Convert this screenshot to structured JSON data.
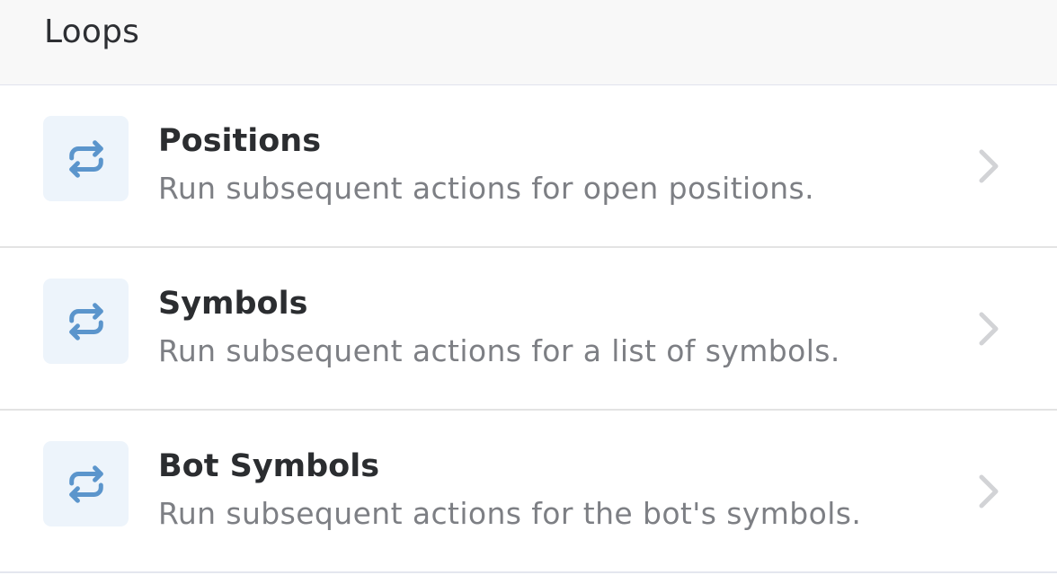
{
  "section": {
    "title": "Loops"
  },
  "accent_color": "#5b95cc",
  "items": [
    {
      "icon": "repeat-icon",
      "title": "Positions",
      "description": "Run subsequent actions for open positions."
    },
    {
      "icon": "repeat-icon",
      "title": "Symbols",
      "description": "Run subsequent actions for a list of symbols."
    },
    {
      "icon": "repeat-icon",
      "title": "Bot Symbols",
      "description": "Run subsequent actions for the bot's symbols."
    }
  ]
}
